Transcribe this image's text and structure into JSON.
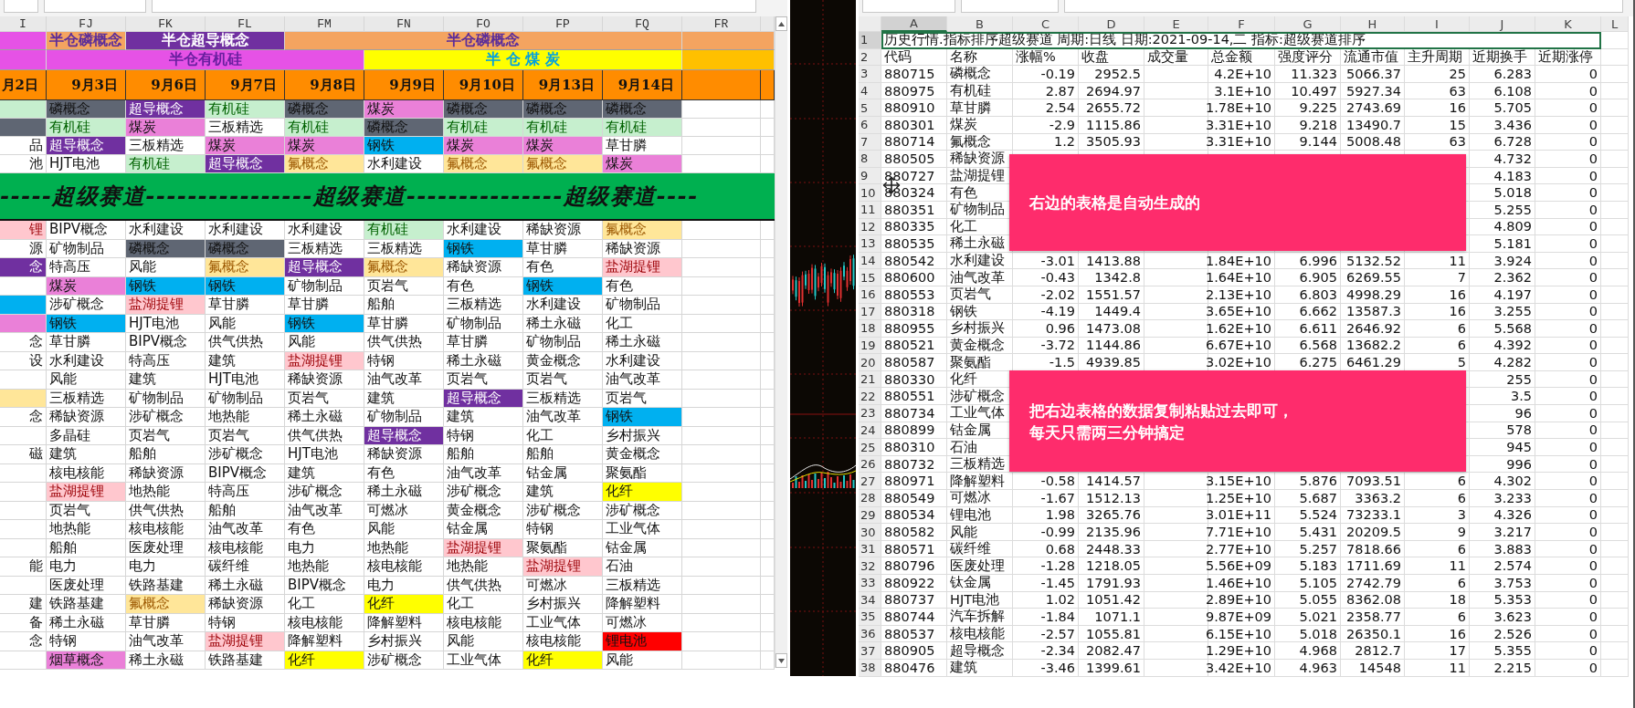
{
  "left_sheet": {
    "column_headers": [
      "I",
      "FJ",
      "FK",
      "FL",
      "FM",
      "FN",
      "FO",
      "FP",
      "FQ",
      "FR"
    ],
    "band_1": [
      {
        "color": "#e652e6"
      },
      {
        "text": "半仓磷概念",
        "color": "#f4a460"
      },
      {
        "text": "半仓超导概念",
        "color": "#7030a0"
      },
      {
        "text": "半仓磷概念",
        "color": "#f4a460"
      },
      {
        "color": "#f4a460"
      }
    ],
    "band_2": [
      {
        "color": "#e652e6"
      },
      {
        "text": "半仓有机硅",
        "color": "#e652e6"
      },
      {
        "text": "半 仓 煤 炭",
        "color": "#ffff00"
      },
      {
        "color": "#ffc000"
      }
    ],
    "dates": [
      "月2日",
      "9月3日",
      "9月6日",
      "9月7日",
      "9月8日",
      "9月9日",
      "9月10日",
      "9月13日",
      "9月14日"
    ],
    "top_rows": [
      [
        {
          "color": "#c6efce"
        },
        {
          "text": "磷概念",
          "color": "#5f6673"
        },
        {
          "text": "超导概念",
          "color": "#7030a0"
        },
        {
          "text": "有机硅",
          "color": "#c6efce"
        },
        {
          "text": "磷概念",
          "color": "#5f6673"
        },
        {
          "text": "煤炭",
          "color": "#ea80d8"
        },
        {
          "text": "磷概念",
          "color": "#5f6673"
        },
        {
          "text": "磷概念",
          "color": "#5f6673"
        },
        {
          "text": "磷概念",
          "color": "#5f6673"
        }
      ],
      [
        {
          "color": "#5f6673"
        },
        {
          "text": "有机硅",
          "color": "#c6efce"
        },
        {
          "text": "煤炭",
          "color": "#ea80d8"
        },
        {
          "text": "三板精选"
        },
        {
          "text": "有机硅",
          "color": "#c6efce"
        },
        {
          "text": "磷概念",
          "color": "#5f6673"
        },
        {
          "text": "有机硅",
          "color": "#c6efce"
        },
        {
          "text": "有机硅",
          "color": "#c6efce"
        },
        {
          "text": "有机硅",
          "color": "#c6efce"
        }
      ],
      [
        {
          "text": "品"
        },
        {
          "text": "超导概念",
          "color": "#7030a0"
        },
        {
          "text": "三板精选"
        },
        {
          "text": "煤炭",
          "color": "#ea80d8"
        },
        {
          "text": "煤炭",
          "color": "#ea80d8"
        },
        {
          "text": "钢铁",
          "color": "#00b0f0"
        },
        {
          "text": "煤炭",
          "color": "#ea80d8"
        },
        {
          "text": "煤炭",
          "color": "#ea80d8"
        },
        {
          "text": "草甘膦"
        }
      ],
      [
        {
          "text": "池"
        },
        {
          "text": "HJT电池"
        },
        {
          "text": "有机硅",
          "color": "#c6efce"
        },
        {
          "text": "超导概念",
          "color": "#7030a0"
        },
        {
          "text": "氟概念",
          "color": "#ffe699"
        },
        {
          "text": "水利建设"
        },
        {
          "text": "氟概念",
          "color": "#ffe699"
        },
        {
          "text": "氟概念",
          "color": "#ffe699"
        },
        {
          "text": "煤炭",
          "color": "#ea80d8"
        }
      ]
    ],
    "banner": "-----超级赛道----------------超级赛道---------------超级赛道----",
    "rows": [
      [
        {
          "text": "锂",
          "color": "#ffc7ce"
        },
        {
          "text": "BIPV概念"
        },
        {
          "text": "水利建设"
        },
        {
          "text": "水利建设"
        },
        {
          "text": "水利建设"
        },
        {
          "text": "有机硅",
          "color": "#c6efce"
        },
        {
          "text": "水利建设"
        },
        {
          "text": "稀缺资源"
        },
        {
          "text": "氟概念",
          "color": "#ffe699"
        }
      ],
      [
        {
          "text": "源"
        },
        {
          "text": "矿物制品"
        },
        {
          "text": "磷概念",
          "color": "#5f6673"
        },
        {
          "text": "磷概念",
          "color": "#5f6673"
        },
        {
          "text": "三板精选"
        },
        {
          "text": "三板精选"
        },
        {
          "text": "钢铁",
          "color": "#00b0f0"
        },
        {
          "text": "草甘膦"
        },
        {
          "text": "稀缺资源"
        }
      ],
      [
        {
          "text": "念",
          "color": "#7030a0"
        },
        {
          "text": "特高压"
        },
        {
          "text": "风能"
        },
        {
          "text": "氟概念",
          "color": "#ffe699"
        },
        {
          "text": "超导概念",
          "color": "#7030a0"
        },
        {
          "text": "氟概念",
          "color": "#ffe699"
        },
        {
          "text": "稀缺资源"
        },
        {
          "text": "有色"
        },
        {
          "text": "盐湖提锂",
          "color": "#ffc7ce"
        }
      ],
      [
        {},
        {
          "text": "煤炭",
          "color": "#ea80d8"
        },
        {
          "text": "钢铁",
          "color": "#00b0f0"
        },
        {
          "text": "钢铁",
          "color": "#00b0f0"
        },
        {
          "text": "矿物制品"
        },
        {
          "text": "页岩气"
        },
        {
          "text": "有色"
        },
        {
          "text": "钢铁",
          "color": "#00b0f0"
        },
        {
          "text": "有色"
        }
      ],
      [
        {
          "color": "#00b0f0"
        },
        {
          "text": "涉矿概念"
        },
        {
          "text": "盐湖提锂",
          "color": "#ffc7ce"
        },
        {
          "text": "草甘膦"
        },
        {
          "text": "草甘膦"
        },
        {
          "text": "船舶"
        },
        {
          "text": "三板精选"
        },
        {
          "text": "水利建设"
        },
        {
          "text": "矿物制品"
        }
      ],
      [
        {
          "color": "#ea80d8"
        },
        {
          "text": "钢铁",
          "color": "#00b0f0"
        },
        {
          "text": "HJT电池"
        },
        {
          "text": "风能"
        },
        {
          "text": "钢铁",
          "color": "#00b0f0"
        },
        {
          "text": "草甘膦"
        },
        {
          "text": "矿物制品"
        },
        {
          "text": "稀土永磁"
        },
        {
          "text": "化工"
        }
      ],
      [
        {
          "text": "念"
        },
        {
          "text": "草甘膦"
        },
        {
          "text": "BIPV概念"
        },
        {
          "text": "供气供热"
        },
        {
          "text": "风能"
        },
        {
          "text": "供气供热"
        },
        {
          "text": "草甘膦"
        },
        {
          "text": "矿物制品"
        },
        {
          "text": "稀土永磁"
        }
      ],
      [
        {
          "text": "设"
        },
        {
          "text": "水利建设"
        },
        {
          "text": "特高压"
        },
        {
          "text": "建筑"
        },
        {
          "text": "盐湖提锂",
          "color": "#ffc7ce"
        },
        {
          "text": "特钢"
        },
        {
          "text": "稀土永磁"
        },
        {
          "text": "黄金概念"
        },
        {
          "text": "水利建设"
        }
      ],
      [
        {},
        {
          "text": "风能"
        },
        {
          "text": "建筑"
        },
        {
          "text": "HJT电池"
        },
        {
          "text": "稀缺资源"
        },
        {
          "text": "油气改革"
        },
        {
          "text": "页岩气"
        },
        {
          "text": "页岩气"
        },
        {
          "text": "油气改革"
        }
      ],
      [
        {
          "color": "#ffe699"
        },
        {
          "text": "三板精选"
        },
        {
          "text": "矿物制品"
        },
        {
          "text": "矿物制品"
        },
        {
          "text": "页岩气"
        },
        {
          "text": "建筑"
        },
        {
          "text": "超导概念",
          "color": "#7030a0"
        },
        {
          "text": "三板精选"
        },
        {
          "text": "页岩气"
        }
      ],
      [
        {
          "text": "念"
        },
        {
          "text": "稀缺资源"
        },
        {
          "text": "涉矿概念"
        },
        {
          "text": "地热能"
        },
        {
          "text": "稀土永磁"
        },
        {
          "text": "矿物制品"
        },
        {
          "text": "建筑"
        },
        {
          "text": "油气改革"
        },
        {
          "text": "钢铁",
          "color": "#00b0f0"
        }
      ],
      [
        {},
        {
          "text": "多晶硅"
        },
        {
          "text": "页岩气"
        },
        {
          "text": "页岩气"
        },
        {
          "text": "供气供热"
        },
        {
          "text": "超导概念",
          "color": "#7030a0"
        },
        {
          "text": "特钢"
        },
        {
          "text": "化工"
        },
        {
          "text": "乡村振兴"
        }
      ],
      [
        {
          "text": "磁"
        },
        {
          "text": "建筑"
        },
        {
          "text": "船舶"
        },
        {
          "text": "涉矿概念"
        },
        {
          "text": "HJT电池"
        },
        {
          "text": "稀缺资源"
        },
        {
          "text": "船舶"
        },
        {
          "text": "船舶"
        },
        {
          "text": "黄金概念"
        }
      ],
      [
        {},
        {
          "text": "核电核能"
        },
        {
          "text": "稀缺资源"
        },
        {
          "text": "BIPV概念"
        },
        {
          "text": "建筑"
        },
        {
          "text": "有色"
        },
        {
          "text": "油气改革"
        },
        {
          "text": "钴金属"
        },
        {
          "text": "聚氨酯"
        }
      ],
      [
        {},
        {
          "text": "盐湖提锂",
          "color": "#ffc7ce"
        },
        {
          "text": "地热能"
        },
        {
          "text": "特高压"
        },
        {
          "text": "涉矿概念"
        },
        {
          "text": "稀土永磁"
        },
        {
          "text": "涉矿概念"
        },
        {
          "text": "建筑"
        },
        {
          "text": "化纤",
          "color": "#ffff00"
        }
      ],
      [
        {},
        {
          "text": "页岩气"
        },
        {
          "text": "供气供热"
        },
        {
          "text": "船舶"
        },
        {
          "text": "油气改革"
        },
        {
          "text": "可燃冰"
        },
        {
          "text": "黄金概念"
        },
        {
          "text": "涉矿概念"
        },
        {
          "text": "涉矿概念"
        }
      ],
      [
        {},
        {
          "text": "地热能"
        },
        {
          "text": "核电核能"
        },
        {
          "text": "油气改革"
        },
        {
          "text": "有色"
        },
        {
          "text": "风能"
        },
        {
          "text": "钴金属"
        },
        {
          "text": "特钢"
        },
        {
          "text": "工业气体"
        }
      ],
      [
        {},
        {
          "text": "船舶"
        },
        {
          "text": "医废处理"
        },
        {
          "text": "核电核能"
        },
        {
          "text": "电力"
        },
        {
          "text": "地热能"
        },
        {
          "text": "盐湖提锂",
          "color": "#ffc7ce"
        },
        {
          "text": "聚氨酯"
        },
        {
          "text": "钴金属"
        }
      ],
      [
        {
          "text": "能"
        },
        {
          "text": "电力"
        },
        {
          "text": "电力"
        },
        {
          "text": "碳纤维"
        },
        {
          "text": "地热能"
        },
        {
          "text": "核电核能"
        },
        {
          "text": "地热能"
        },
        {
          "text": "盐湖提锂",
          "color": "#ffc7ce"
        },
        {
          "text": "石油"
        }
      ],
      [
        {},
        {
          "text": "医废处理"
        },
        {
          "text": "铁路基建"
        },
        {
          "text": "稀土永磁"
        },
        {
          "text": "BIPV概念"
        },
        {
          "text": "电力"
        },
        {
          "text": "供气供热"
        },
        {
          "text": "可燃冰"
        },
        {
          "text": "三板精选"
        }
      ],
      [
        {
          "text": "建"
        },
        {
          "text": "铁路基建"
        },
        {
          "text": "氟概念",
          "color": "#ffe699"
        },
        {
          "text": "稀缺资源"
        },
        {
          "text": "化工"
        },
        {
          "text": "化纤",
          "color": "#ffff00"
        },
        {
          "text": "化工"
        },
        {
          "text": "乡村振兴"
        },
        {
          "text": "降解塑料"
        }
      ],
      [
        {
          "text": "备"
        },
        {
          "text": "稀土永磁"
        },
        {
          "text": "草甘膦"
        },
        {
          "text": "特钢"
        },
        {
          "text": "核电核能"
        },
        {
          "text": "降解塑料"
        },
        {
          "text": "核电核能"
        },
        {
          "text": "工业气体"
        },
        {
          "text": "可燃冰"
        }
      ],
      [
        {
          "text": "念"
        },
        {
          "text": "特钢"
        },
        {
          "text": "油气改革"
        },
        {
          "text": "盐湖提锂",
          "color": "#ffc7ce"
        },
        {
          "text": "降解塑料"
        },
        {
          "text": "乡村振兴"
        },
        {
          "text": "风能"
        },
        {
          "text": "核电核能"
        },
        {
          "text": "锂电池",
          "color": "#ff0000"
        }
      ],
      [
        {},
        {
          "text": "烟草概念",
          "color": "#ea80d8"
        },
        {
          "text": "稀土永磁"
        },
        {
          "text": "铁路基建"
        },
        {
          "text": "化纤",
          "color": "#ffff00"
        },
        {
          "text": "涉矿概念"
        },
        {
          "text": "工业气体"
        },
        {
          "text": "化纤",
          "color": "#ffff00"
        },
        {
          "text": "风能"
        }
      ]
    ]
  },
  "right_sheet": {
    "column_headers": [
      "A",
      "B",
      "C",
      "D",
      "E",
      "F",
      "G",
      "H",
      "I",
      "J",
      "K",
      "L"
    ],
    "title_row": {
      "row": "1",
      "text": "历史行情.指标排序超级赛道 周期:日线 日期:2021-09-14,二 指标:超级赛道排序",
      "selected": true
    },
    "header_row": {
      "row": "2",
      "cells": [
        "代码",
        "名称",
        "涨幅%",
        "收盘",
        "成交量",
        "总金额",
        "强度评分",
        "流通市值",
        "主升周期",
        "近期换手",
        "近期涨停"
      ]
    },
    "rows": [
      {
        "row": "3",
        "A": "880715",
        "B": "磷概念",
        "C": "-0.19",
        "D": "2952.5",
        "F": "4.2E+10",
        "G": "11.323",
        "H": "5066.37",
        "I": "25",
        "J": "6.283",
        "K": "0"
      },
      {
        "row": "4",
        "A": "880975",
        "B": "有机硅",
        "C": "2.87",
        "D": "2694.97",
        "F": "3.1E+10",
        "G": "10.497",
        "H": "5927.34",
        "I": "63",
        "J": "6.108",
        "K": "0"
      },
      {
        "row": "5",
        "A": "880910",
        "B": "草甘膦",
        "C": "2.54",
        "D": "2655.72",
        "F": "1.78E+10",
        "G": "9.225",
        "H": "2743.69",
        "I": "16",
        "J": "5.705",
        "K": "0"
      },
      {
        "row": "6",
        "A": "880301",
        "B": "煤炭",
        "C": "-2.9",
        "D": "1115.86",
        "F": "3.31E+10",
        "G": "9.218",
        "H": "13490.7",
        "I": "15",
        "J": "3.436",
        "K": "0"
      },
      {
        "row": "7",
        "A": "880714",
        "B": "氟概念",
        "C": "1.2",
        "D": "3505.93",
        "F": "3.31E+10",
        "G": "9.144",
        "H": "5008.48",
        "I": "63",
        "J": "6.728",
        "K": "0"
      },
      {
        "row": "8",
        "A": "880505",
        "B": "稀缺资源",
        "J": "4.732",
        "K": "0"
      },
      {
        "row": "9",
        "A": "880727",
        "B": "盐湖提锂",
        "J": "4.183",
        "K": "0"
      },
      {
        "row": "10",
        "A": "880324",
        "B": "有色",
        "J": "5.018",
        "K": "0"
      },
      {
        "row": "11",
        "A": "880351",
        "B": "矿物制品",
        "J": "5.255",
        "K": "0"
      },
      {
        "row": "12",
        "A": "880335",
        "B": "化工",
        "J": "4.809",
        "K": "0"
      },
      {
        "row": "13",
        "A": "880535",
        "B": "稀土永磁",
        "J": "5.181",
        "K": "0"
      },
      {
        "row": "14",
        "A": "880542",
        "B": "水利建设",
        "C": "-3.01",
        "D": "1413.88",
        "F": "1.84E+10",
        "G": "6.996",
        "H": "5132.52",
        "I": "11",
        "J": "3.924",
        "K": "0"
      },
      {
        "row": "15",
        "A": "880600",
        "B": "油气改革",
        "C": "-0.43",
        "D": "1342.8",
        "F": "1.64E+10",
        "G": "6.905",
        "H": "6269.55",
        "I": "7",
        "J": "2.362",
        "K": "0"
      },
      {
        "row": "16",
        "A": "880553",
        "B": "页岩气",
        "C": "-2.02",
        "D": "1551.57",
        "F": "2.13E+10",
        "G": "6.803",
        "H": "4998.29",
        "I": "16",
        "J": "4.197",
        "K": "0"
      },
      {
        "row": "17",
        "A": "880318",
        "B": "钢铁",
        "C": "-4.19",
        "D": "1449.4",
        "F": "3.65E+10",
        "G": "6.662",
        "H": "13587.3",
        "I": "16",
        "J": "3.255",
        "K": "0"
      },
      {
        "row": "18",
        "A": "880955",
        "B": "乡村振兴",
        "C": "0.96",
        "D": "1473.08",
        "F": "1.62E+10",
        "G": "6.611",
        "H": "2646.92",
        "I": "6",
        "J": "5.568",
        "K": "0"
      },
      {
        "row": "19",
        "A": "880521",
        "B": "黄金概念",
        "C": "-3.72",
        "D": "1144.86",
        "F": "6.67E+10",
        "G": "6.568",
        "H": "13682.2",
        "I": "6",
        "J": "4.392",
        "K": "0"
      },
      {
        "row": "20",
        "A": "880587",
        "B": "聚氨酯",
        "C": "-1.5",
        "D": "4939.85",
        "F": "3.02E+10",
        "G": "6.275",
        "H": "6461.29",
        "I": "5",
        "J": "4.282",
        "K": "0"
      },
      {
        "row": "21",
        "A": "880330",
        "B": "化纤",
        "J": "255",
        "K": "0"
      },
      {
        "row": "22",
        "A": "880551",
        "B": "涉矿概念",
        "J": "3.5",
        "K": "0"
      },
      {
        "row": "23",
        "A": "880734",
        "B": "工业气体",
        "J": "96",
        "K": "0"
      },
      {
        "row": "24",
        "A": "880899",
        "B": "钴金属",
        "J": "578",
        "K": "0"
      },
      {
        "row": "25",
        "A": "880310",
        "B": "石油",
        "J": "945",
        "K": "0"
      },
      {
        "row": "26",
        "A": "880732",
        "B": "三板精选",
        "J": "996",
        "K": "0"
      },
      {
        "row": "27",
        "A": "880971",
        "B": "降解塑料",
        "C": "-0.58",
        "D": "1414.57",
        "F": "3.15E+10",
        "G": "5.876",
        "H": "7093.51",
        "I": "6",
        "J": "4.302",
        "K": "0"
      },
      {
        "row": "28",
        "A": "880549",
        "B": "可燃冰",
        "C": "-1.67",
        "D": "1512.13",
        "F": "1.25E+10",
        "G": "5.687",
        "H": "3363.2",
        "I": "6",
        "J": "3.233",
        "K": "0"
      },
      {
        "row": "29",
        "A": "880534",
        "B": "锂电池",
        "C": "1.98",
        "D": "3265.76",
        "F": "3.01E+11",
        "G": "5.524",
        "H": "73233.1",
        "I": "3",
        "J": "4.326",
        "K": "0"
      },
      {
        "row": "30",
        "A": "880582",
        "B": "风能",
        "C": "-0.99",
        "D": "2135.96",
        "F": "7.71E+10",
        "G": "5.431",
        "H": "20209.5",
        "I": "9",
        "J": "3.217",
        "K": "0"
      },
      {
        "row": "31",
        "A": "880571",
        "B": "碳纤维",
        "C": "0.68",
        "D": "2448.33",
        "F": "2.77E+10",
        "G": "5.257",
        "H": "7818.66",
        "I": "6",
        "J": "3.883",
        "K": "0"
      },
      {
        "row": "32",
        "A": "880796",
        "B": "医废处理",
        "C": "-1.28",
        "D": "1218.05",
        "F": "5.56E+09",
        "G": "5.183",
        "H": "1711.69",
        "I": "11",
        "J": "2.574",
        "K": "0"
      },
      {
        "row": "33",
        "A": "880922",
        "B": "钛金属",
        "C": "-1.45",
        "D": "1791.93",
        "F": "1.46E+10",
        "G": "5.105",
        "H": "2742.79",
        "I": "6",
        "J": "3.753",
        "K": "0"
      },
      {
        "row": "34",
        "A": "880737",
        "B": "HJT电池",
        "C": "1.02",
        "D": "1051.42",
        "F": "2.89E+10",
        "G": "5.055",
        "H": "8362.08",
        "I": "18",
        "J": "5.353",
        "K": "0"
      },
      {
        "row": "35",
        "A": "880744",
        "B": "汽车拆解",
        "C": "-1.84",
        "D": "1071.1",
        "F": "9.87E+09",
        "G": "5.021",
        "H": "2358.77",
        "I": "6",
        "J": "3.623",
        "K": "0"
      },
      {
        "row": "36",
        "A": "880537",
        "B": "核电核能",
        "C": "-2.57",
        "D": "1055.81",
        "F": "6.15E+10",
        "G": "5.018",
        "H": "26350.1",
        "I": "16",
        "J": "2.526",
        "K": "0"
      },
      {
        "row": "37",
        "A": "880905",
        "B": "超导概念",
        "C": "-2.34",
        "D": "2082.47",
        "F": "1.29E+10",
        "G": "4.968",
        "H": "2812.7",
        "I": "17",
        "J": "5.355",
        "K": "0"
      },
      {
        "row": "38",
        "A": "880476",
        "B": "建筑",
        "C": "-3.46",
        "D": "1399.61",
        "F": "3.42E+10",
        "G": "4.963",
        "H": "14548",
        "I": "11",
        "J": "2.215",
        "K": "0"
      }
    ]
  },
  "callouts": [
    {
      "text": "右边的表格是自动生成的"
    },
    {
      "text": "把右边表格的数据复制粘贴过去即可，每天只需两三分钟搞定"
    }
  ]
}
